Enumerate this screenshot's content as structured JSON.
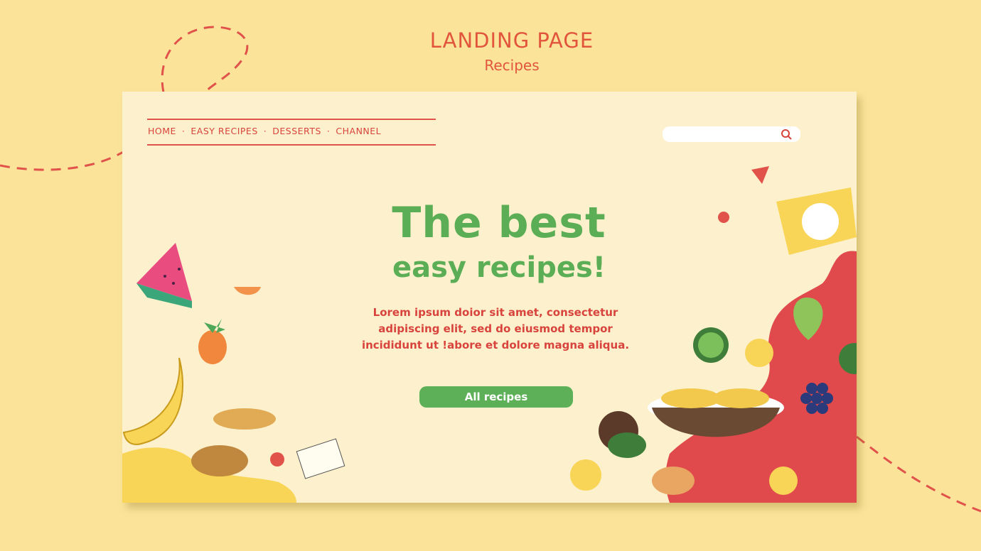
{
  "header": {
    "title": "LANDING PAGE",
    "subtitle": "Recipes"
  },
  "nav": {
    "items": [
      "HOME",
      "EASY RECIPES",
      "DESSERTS",
      "CHANNEL"
    ],
    "separator": "·"
  },
  "search": {
    "placeholder": "",
    "icon": "search-icon"
  },
  "hero": {
    "title": "The best",
    "subtitle": "easy recipes!",
    "body": "Lorem ipsum doior sit amet, consectetur adipiscing elit, sed do eiusmod tempor incididunt ut !abore et dolore magna aliqua.",
    "cta_label": "All recipes"
  },
  "colors": {
    "background": "#fbe49a",
    "card": "#fdf0cc",
    "accent_red": "#e1524a",
    "accent_green": "#5eb058",
    "yellow": "#f8d556"
  }
}
